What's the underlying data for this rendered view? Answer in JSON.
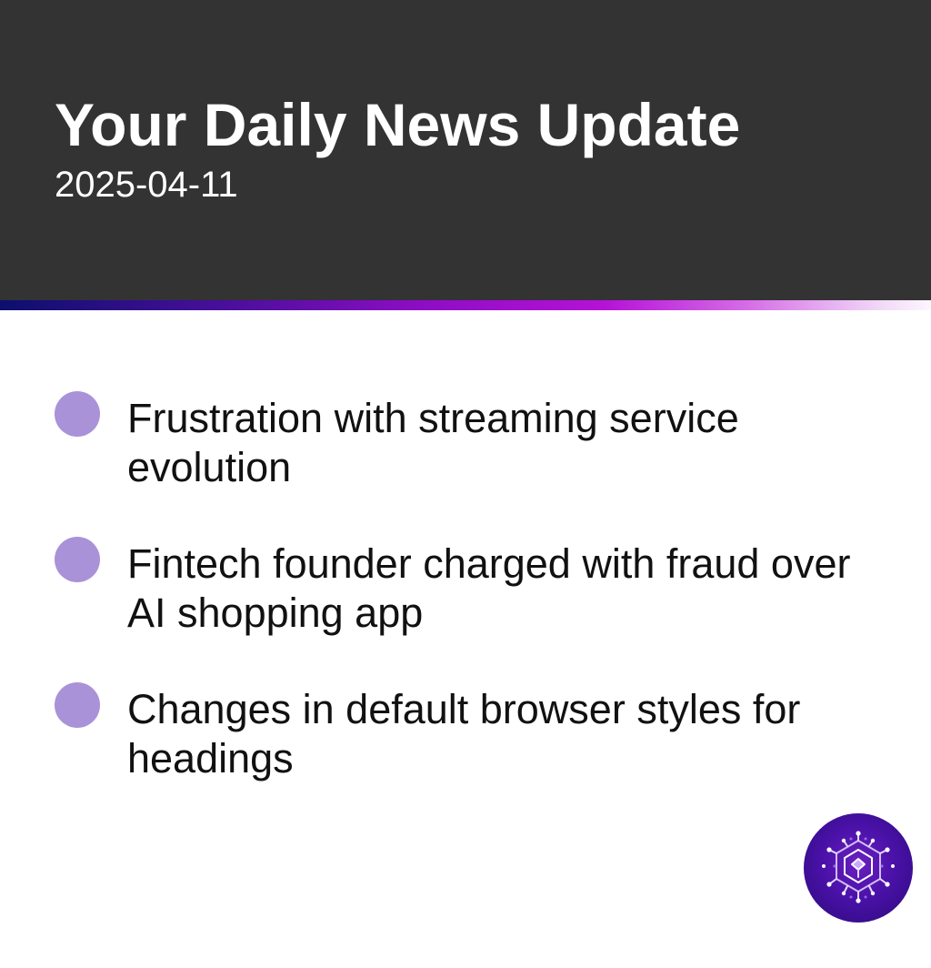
{
  "header": {
    "title": "Your Daily News Update",
    "date": "2025-04-11"
  },
  "news": {
    "items": [
      {
        "text": "Frustration with streaming service evolution"
      },
      {
        "text": "Fintech founder charged with fraud over AI shopping app"
      },
      {
        "text": "Changes in default browser styles for headings"
      }
    ]
  },
  "colors": {
    "header_bg": "#333333",
    "bullet": "#a992d8",
    "logo": "#4a11a8"
  },
  "icons": {
    "logo": "circuit-hexagon-logo-icon"
  }
}
